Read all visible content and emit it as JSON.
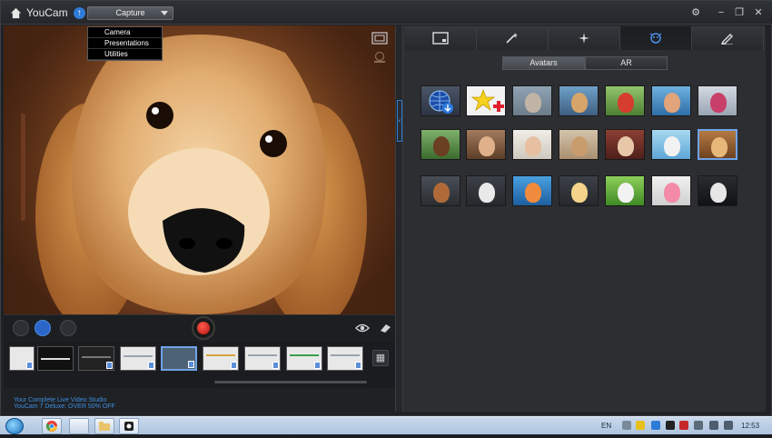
{
  "titlebar": {
    "app_name": "YouCam",
    "mode_selected": "Capture",
    "upgrade_glyph": "↑"
  },
  "preview": {
    "dropdown_items": [
      "Camera",
      "Presentations",
      "Utilities"
    ]
  },
  "promo": {
    "line1": "Your Complete Live Video Studio",
    "line2": "YouCam 7 Deluxe: OVER 50% OFF"
  },
  "right_panel": {
    "subtabs": [
      "Avatars",
      "AR"
    ],
    "active_subtab": "Avatars"
  },
  "taskbar": {
    "language": "EN",
    "clock": "12:53"
  },
  "colors": {
    "accent": "#2f7bd8",
    "record": "#d4221a",
    "panel_bg": "#2c2e31"
  }
}
